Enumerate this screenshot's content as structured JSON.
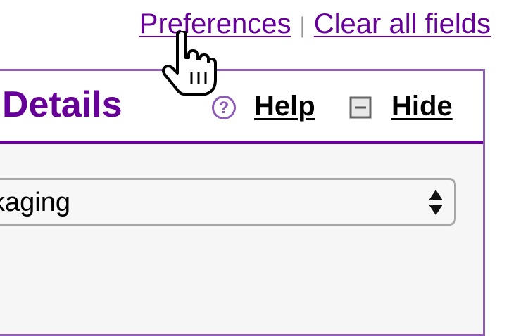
{
  "top_links": {
    "preferences": "Preferences",
    "separator": "|",
    "clear_all": "Clear all fields"
  },
  "panel": {
    "title": "Details",
    "help_label": "Help",
    "hide_label": "Hide",
    "help_icon": "question-circle-icon",
    "hide_icon": "minus-square-icon"
  },
  "select": {
    "value": "kaging",
    "icon": "up-down-arrows-icon"
  },
  "cursor": {
    "icon": "pointing-hand-cursor-icon"
  },
  "colors": {
    "link_purple": "#660099",
    "panel_border": "#8e5cb8",
    "header_rule": "#660099"
  }
}
